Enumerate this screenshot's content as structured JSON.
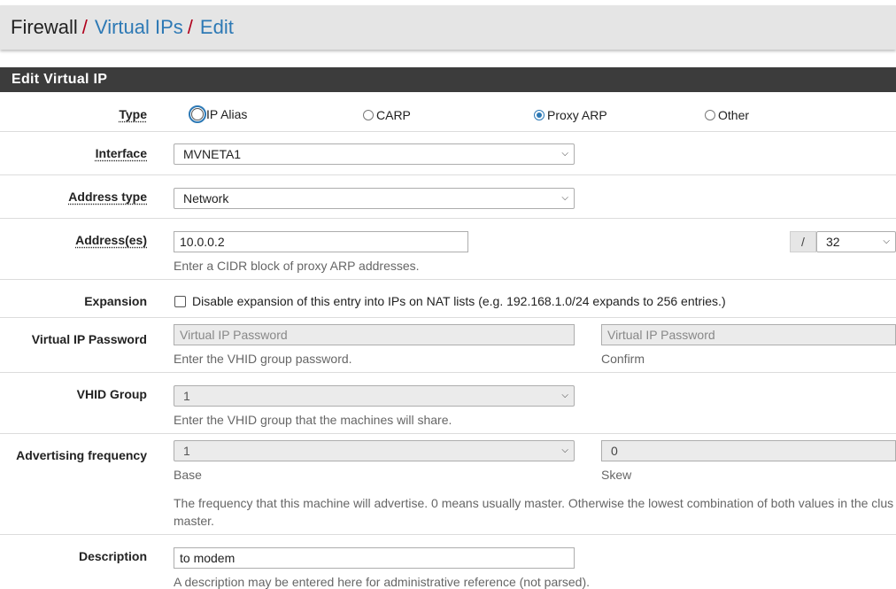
{
  "breadcrumb": {
    "root": "Firewall",
    "sep": "/",
    "parent": "Virtual IPs",
    "current": "Edit"
  },
  "panel": {
    "title": "Edit Virtual IP"
  },
  "type": {
    "label": "Type",
    "options": [
      {
        "label": "IP Alias",
        "checked": false,
        "focused": true
      },
      {
        "label": "CARP",
        "checked": false
      },
      {
        "label": "Proxy ARP",
        "checked": true
      },
      {
        "label": "Other",
        "checked": false
      }
    ]
  },
  "interface": {
    "label": "Interface",
    "value": "MVNETA1"
  },
  "address_type": {
    "label": "Address type",
    "value": "Network"
  },
  "addresses": {
    "label": "Address(es)",
    "value": "10.0.0.2",
    "mask_sep": "/",
    "mask": "32",
    "help": "Enter a CIDR block of proxy ARP addresses."
  },
  "expansion": {
    "label": "Expansion",
    "checkbox_text": "Disable expansion of this entry into IPs on NAT lists (e.g. 192.168.1.0/24 expands to 256 entries.)",
    "checked": false
  },
  "vip_password": {
    "label": "Virtual IP Password",
    "placeholder": "Virtual IP Password",
    "confirm_placeholder": "Virtual IP Password",
    "help": "Enter the VHID group password.",
    "confirm_help": "Confirm"
  },
  "vhid_group": {
    "label": "VHID Group",
    "value": "1",
    "help": "Enter the VHID group that the machines will share."
  },
  "advertising": {
    "label": "Advertising frequency",
    "base_value": "1",
    "skew_value": "0",
    "base_help": "Base",
    "skew_help": "Skew",
    "help_line1": "The frequency that this machine will advertise. 0 means usually master. Otherwise the lowest combination of both values in the clus",
    "help_line2": "master."
  },
  "description": {
    "label": "Description",
    "value": "to modem",
    "help": "A description may be entered here for administrative reference (not parsed)."
  },
  "colors": {
    "heading_bg": "#3c3c3c",
    "link": "#2d79b5",
    "separator": "#b0001c"
  }
}
